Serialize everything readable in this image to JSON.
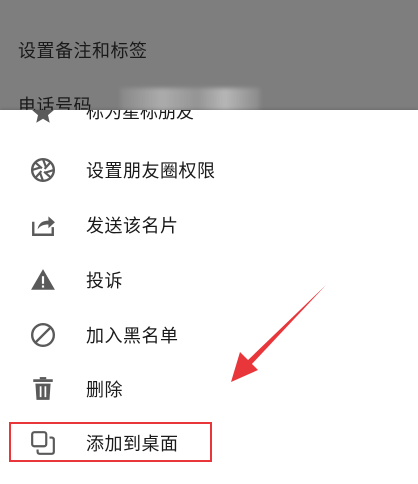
{
  "background": {
    "row1_label": "设置备注和标签",
    "row2_label": "电话号码"
  },
  "menu": {
    "partial_item": "标为星标朋友",
    "items": [
      {
        "label": "设置朋友圈权限",
        "icon": "aperture-icon"
      },
      {
        "label": "发送该名片",
        "icon": "share-icon"
      },
      {
        "label": "投诉",
        "icon": "warning-icon"
      },
      {
        "label": "加入黑名单",
        "icon": "block-icon"
      },
      {
        "label": "删除",
        "icon": "trash-icon"
      },
      {
        "label": "添加到桌面",
        "icon": "add-to-desktop-icon"
      }
    ]
  },
  "annotation": {
    "highlight_color": "#e8363a",
    "highlighted_item": "添加到桌面"
  },
  "colors": {
    "icon": "#5a5a5a",
    "text": "#1a1a1a",
    "overlay": "#7e7e7e"
  }
}
